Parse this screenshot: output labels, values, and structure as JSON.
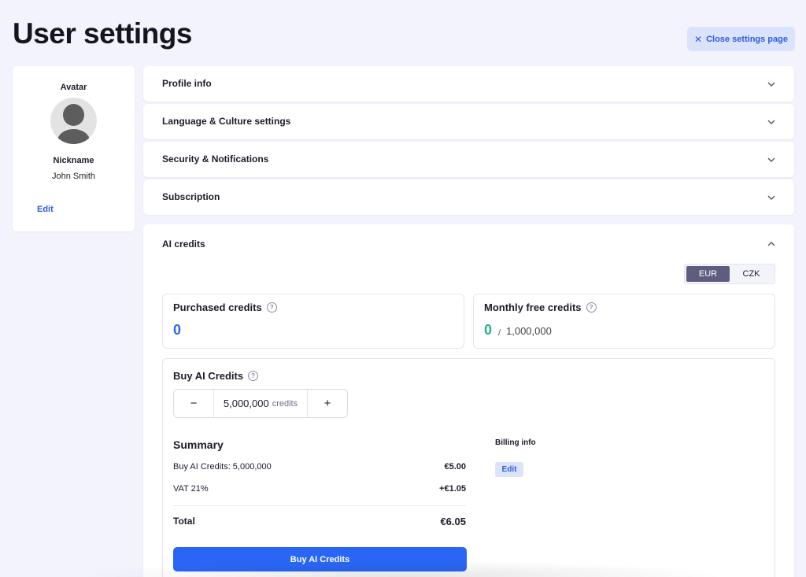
{
  "page": {
    "title": "User settings"
  },
  "header": {
    "close_label": "Close settings page"
  },
  "profile": {
    "avatar_label": "Avatar",
    "nickname_label": "Nickname",
    "nickname": "John Smith",
    "edit_label": "Edit"
  },
  "sections": [
    {
      "label": "Profile info"
    },
    {
      "label": "Language & Culture settings"
    },
    {
      "label": "Security & Notifications"
    },
    {
      "label": "Subscription"
    },
    {
      "label": "AI credits"
    }
  ],
  "ai_credits": {
    "currency_options": [
      "EUR",
      "CZK"
    ],
    "currency_selected": "EUR",
    "purchased": {
      "label": "Purchased credits",
      "value": "0"
    },
    "monthly_free": {
      "label": "Monthly free credits",
      "value": "0",
      "separator": "/",
      "limit": "1,000,000"
    },
    "buy": {
      "title": "Buy AI Credits",
      "minus": "−",
      "plus": "+",
      "amount": "5,000,000",
      "unit": "credits"
    },
    "summary": {
      "title": "Summary",
      "rows": [
        {
          "label": "Buy AI Credits: 5,000,000",
          "amount": "€5.00"
        },
        {
          "label": "VAT 21%",
          "amount": "+€1.05"
        }
      ],
      "total_label": "Total",
      "total_amount": "€6.05"
    },
    "billing": {
      "title": "Billing info",
      "edit_label": "Edit"
    },
    "buy_button_label": "Buy AI Credits"
  },
  "colors": {
    "accent": "#2a66f5",
    "background": "#f2f3fc",
    "selected_toggle": "#5e5d80",
    "free_credits": "#25b584"
  },
  "icons": {
    "close": "close-icon",
    "chevron": "chevron-down-icon",
    "help": "help-circle-icon",
    "avatar": "user-avatar-icon"
  }
}
